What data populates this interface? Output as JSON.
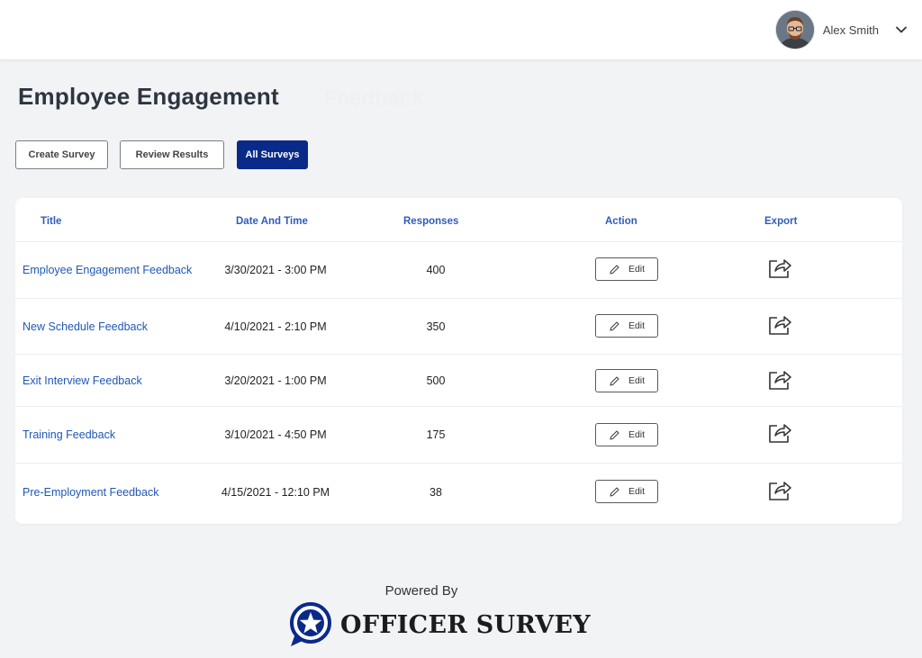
{
  "header": {
    "user_name": "Alex Smith",
    "avatar_icon": "user-avatar",
    "menu_icon": "chevron-down-icon"
  },
  "page": {
    "title": "Employee Engagement",
    "ghost_text": "Feedback"
  },
  "toolbar": {
    "create_label": "Create Survey",
    "review_label": "Review Results",
    "all_label": "All Surveys",
    "active": "All Surveys"
  },
  "table": {
    "columns": [
      "Title",
      "Date And Time",
      "Responses",
      "Action",
      "Export"
    ],
    "rows": [
      {
        "title": "Employee Engagement Feedback",
        "date": "3/30/2021 - 3:00 PM",
        "responses": "400",
        "action": "Edit"
      },
      {
        "title": "New Schedule Feedback",
        "date": "4/10/2021 - 2:10 PM",
        "responses": "350",
        "action": "Edit"
      },
      {
        "title": "Exit Interview Feedback",
        "date": "3/20/2021 - 1:00 PM",
        "responses": "500",
        "action": "Edit"
      },
      {
        "title": "Training Feedback",
        "date": "3/10/2021 - 4:50 PM",
        "responses": "175",
        "action": "Edit"
      },
      {
        "title": "Pre-Employment Feedback",
        "date": "4/15/2021 - 12:10 PM",
        "responses": "38",
        "action": "Edit"
      }
    ]
  },
  "footer": {
    "powered_by": "Powered By",
    "brand": "OFFICER SURVEY",
    "brand_icon": "star-chat-bubble-icon"
  },
  "colors": {
    "primary": "#0a2a8a",
    "link": "#1f58b5",
    "header_text": "#2f5db8",
    "background": "#f2f3f5"
  }
}
